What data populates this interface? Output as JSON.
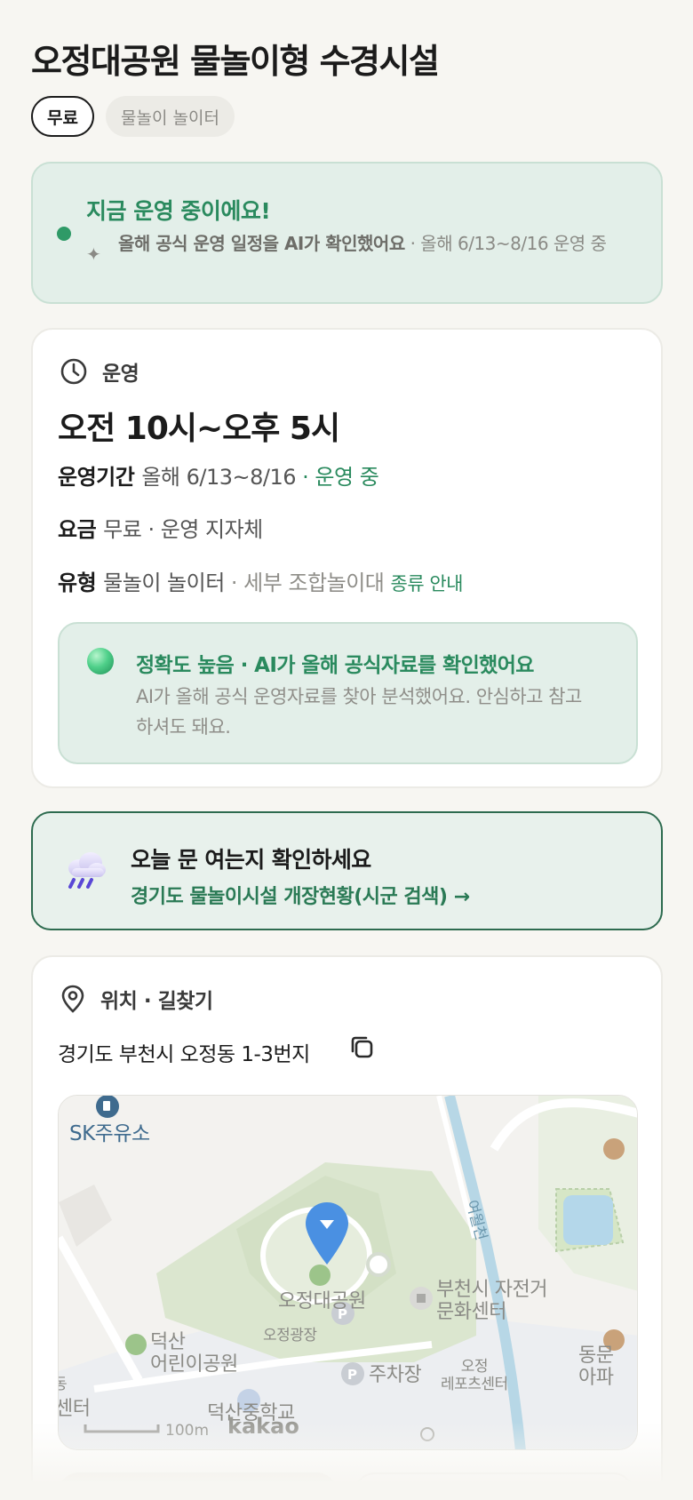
{
  "header": {
    "title": "오정대공원 물놀이형 수경시설",
    "chips": [
      "무료",
      "물놀이 놀이터"
    ]
  },
  "status": {
    "title": "지금 운영 중이에요!",
    "subtitle_bold": "올해 공식 운영 일정을 AI가 확인했어요",
    "subtitle_rest": " · 올해 6/13~8/16 운영 중"
  },
  "operation": {
    "section_label": "운영",
    "hours": "오전 10시~오후 5시",
    "period_key": "운영기간",
    "period_value": "올해 6/13~8/16",
    "period_status": " · 운영 중",
    "fee_key": "요금",
    "fee_value": "무료 · 운영 지자체",
    "type_key": "유형",
    "type_value": "물놀이 놀이터",
    "type_detail": " · 세부 조합놀이대 ",
    "type_link": "종류 안내",
    "accuracy_title": "정확도 높음 · AI가 올해 공식자료를 확인했어요",
    "accuracy_desc": "AI가 올해 공식 운영자료를 찾아 분석했어요. 안심하고 참고하셔도 돼요."
  },
  "check": {
    "title": "오늘 문 여는지 확인하세요",
    "link": "경기도 물놀이시설 개장현황(시군 검색) →"
  },
  "location": {
    "section_label": "위치 · 길찾기",
    "address": "경기도 부천시 오정동 1-3번지",
    "map": {
      "labels": {
        "sk": "SK주유소",
        "park": "오정대공원",
        "square": "오정광장",
        "stream": "여월천",
        "bike_center": "부천시 자전거\n문화센터",
        "kids_park": "덕산\n어린이공원",
        "parking": "주차장",
        "sports": "오정\n레포츠센터",
        "apt": "동문\n아파",
        "school": "덕산중학교",
        "center": "센터",
        "hae": "동"
      },
      "scale": "100m",
      "brand": "kakao"
    }
  },
  "colors": {
    "accent_green": "#2a8a5e",
    "status_bg": "#e3efe9",
    "pin_blue": "#4a90e2"
  }
}
